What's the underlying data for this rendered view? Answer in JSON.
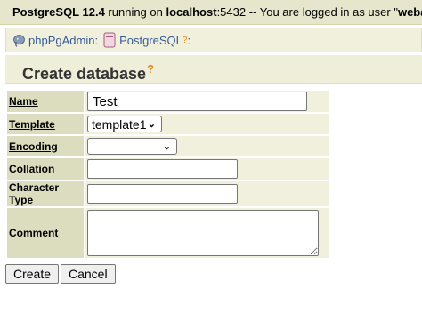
{
  "server_bar": {
    "product": "PostgreSQL 12.4",
    "running_on": " running on ",
    "host": "localhost",
    "port": ":5432",
    "logged_in": " -- You are logged in as user \"",
    "user": "webadmin",
    "close_quote": "\""
  },
  "trail": {
    "app": "phpPgAdmin",
    "sep1": ":",
    "server": "PostgreSQL",
    "help_mark": "?",
    "sep2": ":"
  },
  "page": {
    "title": "Create database",
    "help_mark": "?"
  },
  "form": {
    "name_label": "Name",
    "name_value": "Test",
    "template_label": "Template",
    "template_value": "template1",
    "encoding_label": "Encoding",
    "encoding_value": "",
    "collation_label": "Collation",
    "collation_value": "",
    "ctype_label": "Character Type",
    "ctype_value": "",
    "comment_label": "Comment",
    "comment_value": ""
  },
  "buttons": {
    "create": "Create",
    "cancel": "Cancel"
  },
  "icons": {
    "elephant": "elephant-icon",
    "database": "database-icon",
    "chevron": "chevron-down-icon"
  }
}
